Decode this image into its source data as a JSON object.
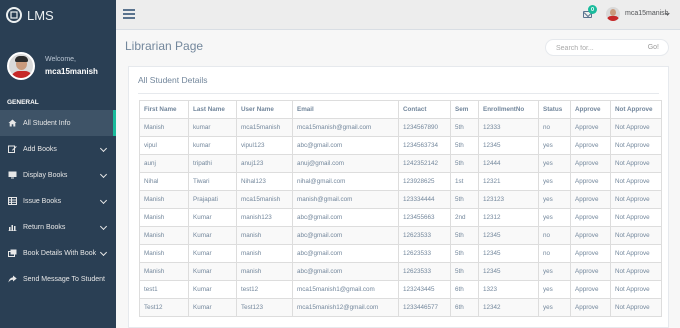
{
  "brand": {
    "title": "LMS"
  },
  "profile": {
    "welcome": "Welcome,",
    "username": "mca15manish"
  },
  "sidebar": {
    "section": "GENERAL",
    "items": [
      {
        "label": "All Student Info",
        "icon": "home-icon",
        "active": true,
        "has_chevron": false
      },
      {
        "label": "Add Books",
        "icon": "edit-icon",
        "has_chevron": true
      },
      {
        "label": "Display Books",
        "icon": "desktop-icon",
        "has_chevron": true
      },
      {
        "label": "Issue Books",
        "icon": "table-icon",
        "has_chevron": true
      },
      {
        "label": "Return Books",
        "icon": "bar-chart-icon",
        "has_chevron": true
      },
      {
        "label": "Book Details With Book",
        "icon": "clone-icon",
        "has_chevron": true
      },
      {
        "label": "Send Message To Student",
        "icon": "share-icon",
        "has_chevron": false
      }
    ]
  },
  "topnav": {
    "menu_icon": "hamburger-icon",
    "mail_icon": "envelope-icon",
    "mail_count": "0",
    "user": "mca15manish"
  },
  "main": {
    "page_title": "Librarian Page",
    "search": {
      "placeholder": "Search for...",
      "button": "Go!"
    },
    "panel_title": "All Student Details",
    "table": {
      "columns": [
        "First Name",
        "Last Name",
        "User Name",
        "Email",
        "Contact",
        "Sem",
        "EnrollmentNo",
        "Status",
        "Approve",
        "Not Approve"
      ],
      "rows": [
        [
          "Manish",
          "kumar",
          "mca15manish",
          "mca15manish@gmail.com",
          "1234567890",
          "5th",
          "12333",
          "no",
          "Approve",
          "Not Approve"
        ],
        [
          "vipul",
          "kumar",
          "vipul123",
          "abc@gmail.com",
          "1234563734",
          "5th",
          "12345",
          "yes",
          "Approve",
          "Not Approve"
        ],
        [
          "aunj",
          "tripathi",
          "anuj123",
          "anuj@gmail.com",
          "1242352142",
          "5th",
          "12444",
          "yes",
          "Approve",
          "Not Approve"
        ],
        [
          "Nihal",
          "Tiwari",
          "Nihal123",
          "nihal@gmail.com",
          "123928625",
          "1st",
          "12321",
          "yes",
          "Approve",
          "Not Approve"
        ],
        [
          "Manish",
          "Prajapati",
          "mca15manish",
          "manish@gmail.com",
          "123334444",
          "5th",
          "123123",
          "yes",
          "Approve",
          "Not Approve"
        ],
        [
          "Manish",
          "Kumar",
          "manish123",
          "abc@gmail.com",
          "123455663",
          "2nd",
          "12312",
          "yes",
          "Approve",
          "Not Approve"
        ],
        [
          "Manish",
          "Kumar",
          "manish",
          "abc@gmail.com",
          "12623533",
          "5th",
          "12345",
          "no",
          "Approve",
          "Not Approve"
        ],
        [
          "Manish",
          "Kumar",
          "manish",
          "abc@gmail.com",
          "12623533",
          "5th",
          "12345",
          "no",
          "Approve",
          "Not Approve"
        ],
        [
          "Manish",
          "Kumar",
          "manish",
          "abc@gmail.com",
          "12623533",
          "5th",
          "12345",
          "yes",
          "Approve",
          "Not Approve"
        ],
        [
          "test1",
          "Kumar",
          "test12",
          "mca15manish1@gmail.com",
          "123243445",
          "6th",
          "1323",
          "yes",
          "Approve",
          "Not Approve"
        ],
        [
          "Test12",
          "Kumar",
          "Test123",
          "mca15manish12@gmail.com",
          "1233446577",
          "6th",
          "12342",
          "yes",
          "Approve",
          "Not Approve"
        ]
      ]
    }
  },
  "colors": {
    "sidebar": "#2a3f54",
    "accent": "#1abb9c",
    "text": "#73879c"
  }
}
